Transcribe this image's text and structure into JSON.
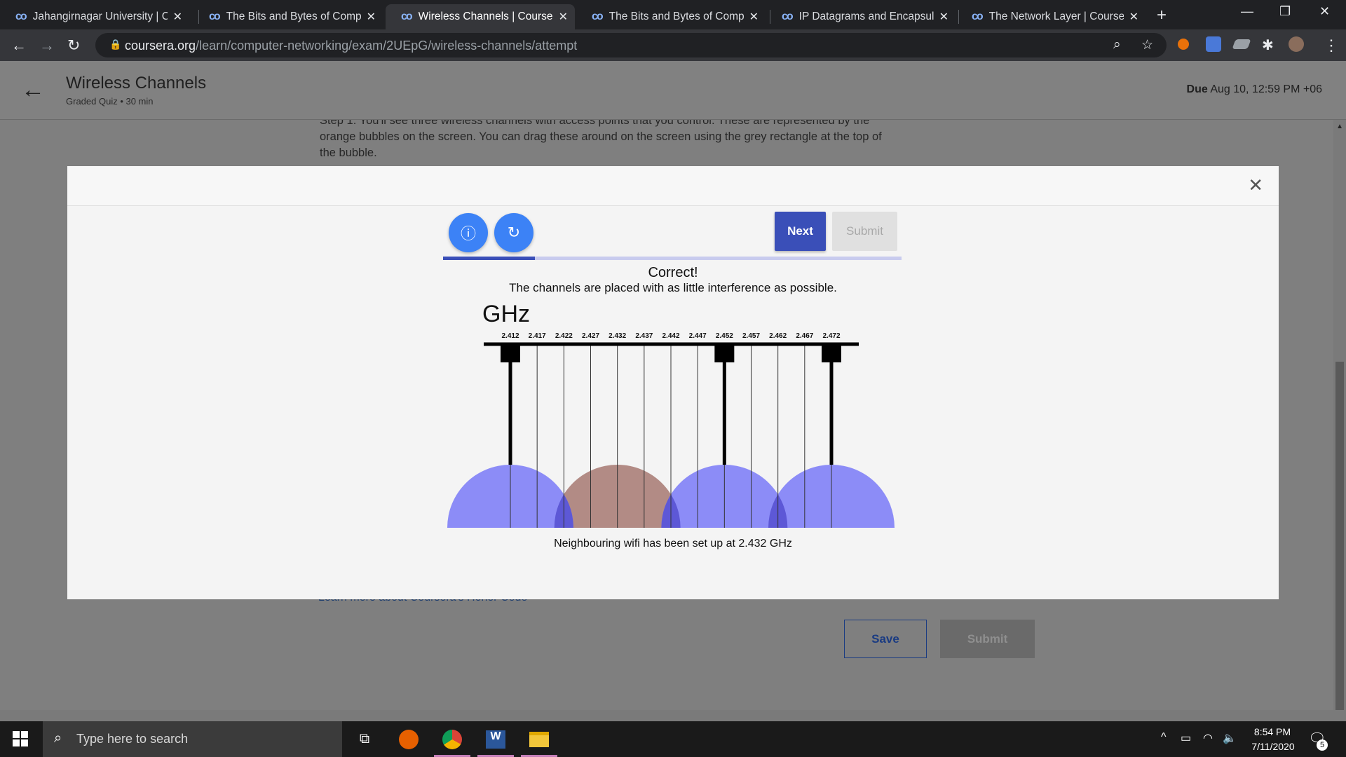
{
  "browser": {
    "tabs": [
      {
        "title": "Jahangirnagar University | Co",
        "active": false
      },
      {
        "title": "The Bits and Bytes of Compu",
        "active": false
      },
      {
        "title": "Wireless Channels | Coursera",
        "active": true
      },
      {
        "title": "The Bits and Bytes of Compu",
        "active": false
      },
      {
        "title": "IP Datagrams and Encapsulat",
        "active": false
      },
      {
        "title": "The Network Layer | Courser",
        "active": false
      }
    ],
    "url_domain": "coursera.org",
    "url_path": "/learn/computer-networking/exam/2UEpG/wireless-channels/attempt"
  },
  "quiz": {
    "title": "Wireless Channels",
    "subtitle": "Graded Quiz • 30 min",
    "due_label": "Due",
    "due_value": "Aug 10, 12:59 PM +06",
    "step_text": "Step 1: You'll see three wireless channels with access points that you control. These are represented by the orange bubbles on the screen. You can drag these around on the screen using the grey rectangle at the top of the bubble.",
    "honor_link": "Learn more about Coursera's Honor Code",
    "save_label": "Save",
    "submit_label": "Submit"
  },
  "modal": {
    "next_label": "Next",
    "submit_label": "Submit",
    "progress_fraction": 0.2,
    "result_title": "Correct!",
    "result_message": "The channels are placed with as little interference as possible.",
    "caption": "Neighbouring wifi has been set up at 2.432 GHz"
  },
  "chart_data": {
    "type": "channel-diagram",
    "unit_label": "GHz",
    "frequencies": [
      "2.412",
      "2.417",
      "2.422",
      "2.427",
      "2.432",
      "2.437",
      "2.442",
      "2.447",
      "2.452",
      "2.457",
      "2.462",
      "2.467",
      "2.472"
    ],
    "access_points": [
      {
        "frequency": 2.412,
        "color": "#8c8cf7"
      },
      {
        "frequency": 2.452,
        "color": "#8c8cf7"
      },
      {
        "frequency": 2.472,
        "color": "#8c8cf7"
      }
    ],
    "neighbour": {
      "frequency": 2.432,
      "color": "#b28b85"
    },
    "overlap_color": "#5d58d6"
  },
  "taskbar": {
    "search_placeholder": "Type here to search",
    "time": "8:54 PM",
    "date": "7/11/2020",
    "notification_count": "5"
  }
}
